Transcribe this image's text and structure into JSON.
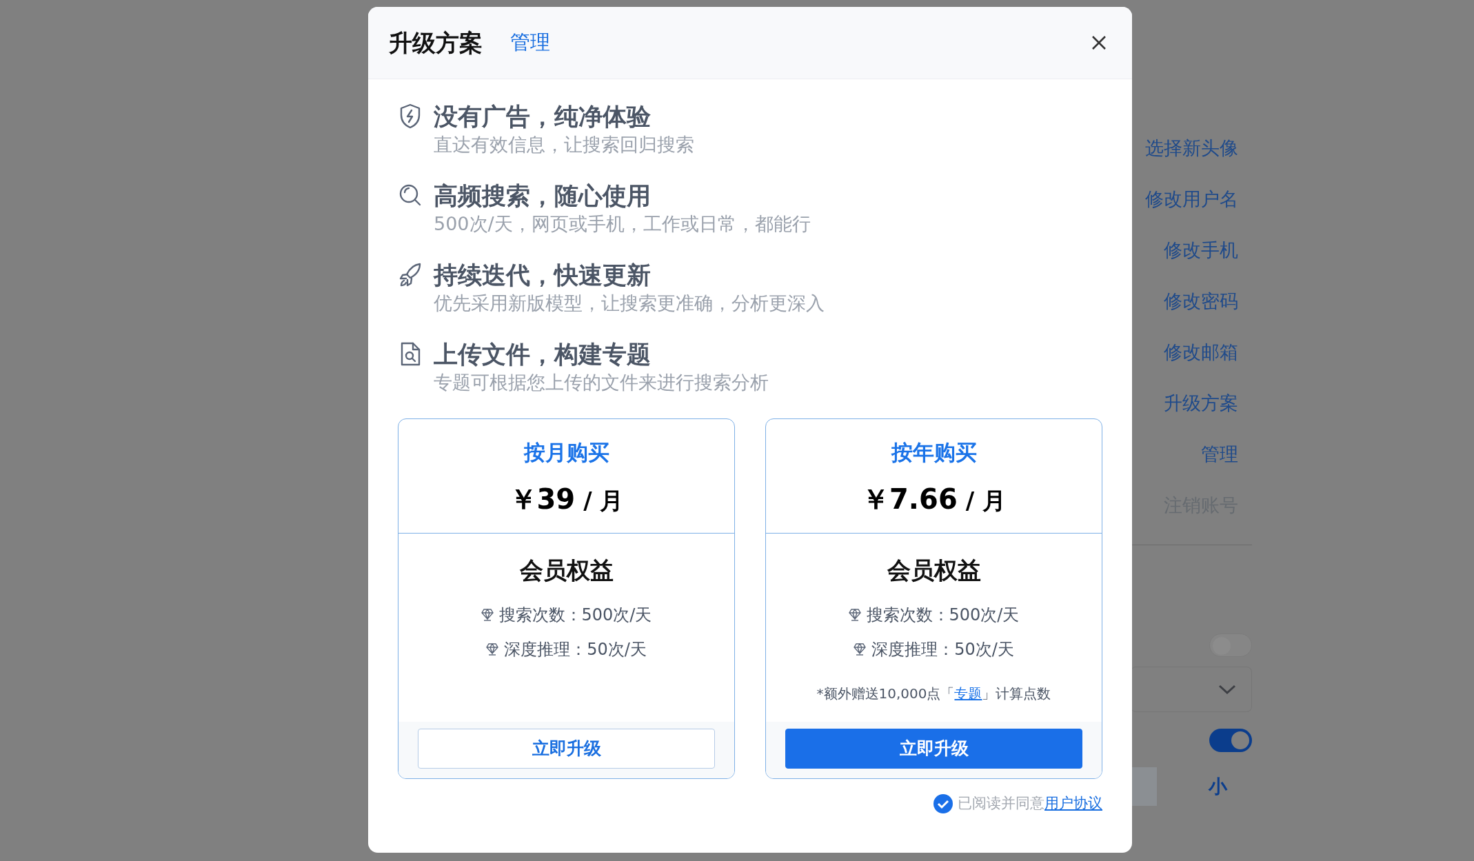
{
  "background_menu": [
    {
      "label": "选择新头像",
      "disabled": false
    },
    {
      "label": "修改用户名",
      "disabled": false
    },
    {
      "label": "修改手机",
      "disabled": false
    },
    {
      "label": "修改密码",
      "disabled": false
    },
    {
      "label": "修改邮箱",
      "disabled": false
    },
    {
      "label": "升级方案",
      "disabled": false
    },
    {
      "label": "管理",
      "disabled": false
    },
    {
      "label": "注销账号",
      "disabled": true
    }
  ],
  "background_settings": {
    "switch_1": {
      "on": false
    },
    "switch_2": {
      "on": true
    },
    "size_option": "小"
  },
  "dialog": {
    "title": "升级方案",
    "manage_link": "管理",
    "features": [
      {
        "kind": "shield",
        "title": "没有广告，纯净体验",
        "description": "直达有效信息，让搜索回归搜索"
      },
      {
        "kind": "search",
        "title": "高频搜索，随心使用",
        "description": "500次/天，网页或手机，工作或日常，都能行"
      },
      {
        "kind": "rocket",
        "title": "持续迭代，快速更新",
        "description": "优先采用新版模型，让搜索更准确，分析更深入"
      },
      {
        "kind": "file",
        "title": "上传文件，构建专题",
        "description": "专题可根据您上传的文件来进行搜索分析"
      }
    ],
    "plans": [
      {
        "name": "按月购买",
        "price": "￥39",
        "unit": "/ 月",
        "benefits_title": "会员权益",
        "benefits": [
          "搜索次数：500次/天",
          "深度推理：50次/天"
        ],
        "primary": false,
        "button": "立即升级"
      },
      {
        "name": "按年购买",
        "price": "￥7.66",
        "unit": "/ 月",
        "benefits_title": "会员权益",
        "benefits": [
          "搜索次数：500次/天",
          "深度推理：50次/天"
        ],
        "note": {
          "before": "*额外赠送10,000点「",
          "link": "专题",
          "after": "」计算点数"
        },
        "primary": true,
        "button": "立即升级"
      }
    ],
    "agreement": {
      "checked": true,
      "text": "已阅读并同意",
      "link": "用户协议"
    }
  }
}
